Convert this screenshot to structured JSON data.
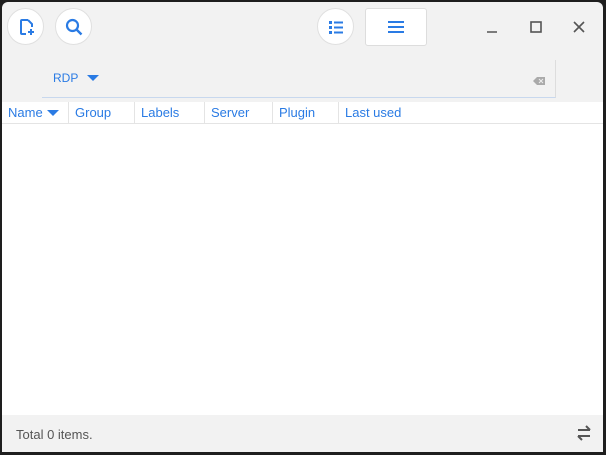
{
  "toolbar": {
    "new_icon": "file-plus-icon",
    "search_icon": "search-icon",
    "list_icon": "list-detail-icon",
    "menu_icon": "hamburger-menu-icon"
  },
  "window_controls": {
    "minimize": "minimize-icon",
    "maximize": "maximize-icon",
    "close": "close-icon"
  },
  "filter": {
    "protocol": "RDP",
    "clear_icon": "backspace-clear-icon"
  },
  "table": {
    "columns": [
      "Name",
      "Group",
      "Labels",
      "Server",
      "Plugin",
      "Last used"
    ],
    "rows": []
  },
  "status": {
    "total": "Total 0 items."
  },
  "colors": {
    "accent": "#2a7be4"
  }
}
